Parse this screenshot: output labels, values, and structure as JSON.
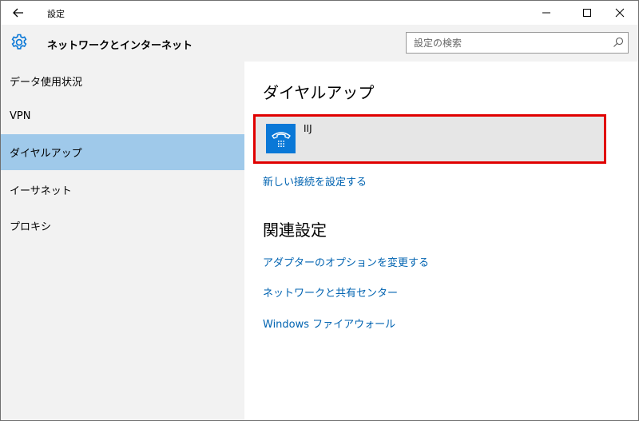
{
  "titlebar": {
    "app_title": "設定",
    "back_icon": "back-arrow-icon",
    "minimize_icon": "minimize-icon",
    "maximize_icon": "maximize-icon",
    "close_icon": "close-icon"
  },
  "header": {
    "icon": "gear-icon",
    "title": "ネットワークとインターネット",
    "search_placeholder": "設定の検索",
    "search_icon": "search-icon"
  },
  "sidebar": {
    "items": [
      {
        "label": "データ使用状況",
        "active": false
      },
      {
        "label": "VPN",
        "active": false
      },
      {
        "label": "ダイヤルアップ",
        "active": true
      },
      {
        "label": "イーサネット",
        "active": false
      },
      {
        "label": "プロキシ",
        "active": false
      }
    ]
  },
  "main": {
    "section_title": "ダイヤルアップ",
    "connection": {
      "name": "IIJ",
      "icon": "dialup-phone-icon"
    },
    "new_connection_link": "新しい接続を設定する",
    "related_title": "関連設定",
    "related_links": [
      "アダプターのオプションを変更する",
      "ネットワークと共有センター",
      "Windows ファイアウォール"
    ]
  },
  "colors": {
    "accent": "#0a78d7",
    "link": "#0063b1",
    "selected_bg": "#9fc9ea",
    "highlight_border": "#e00000",
    "panel_bg": "#f2f2f2"
  }
}
